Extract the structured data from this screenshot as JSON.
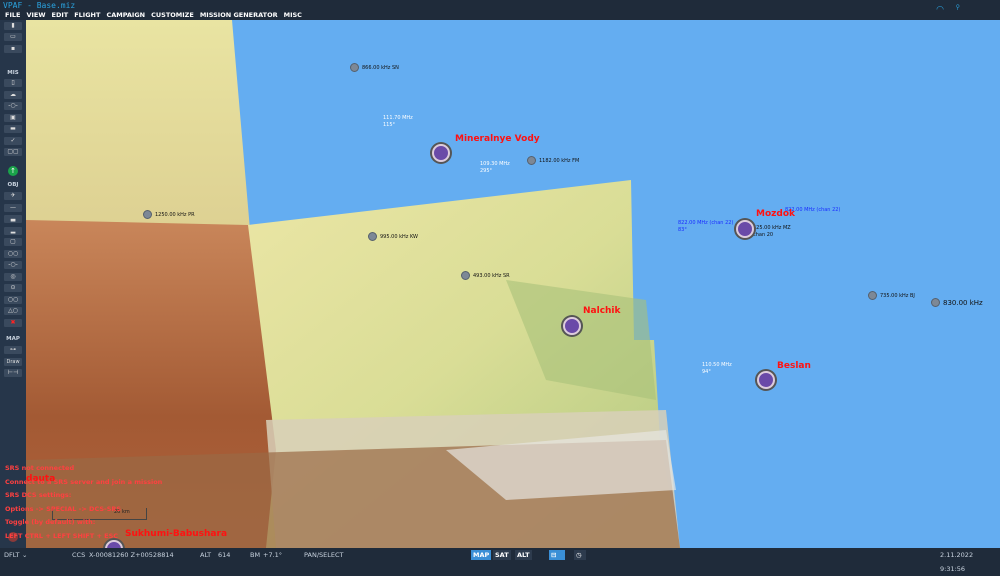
{
  "title": "VPAF - Base.miz",
  "menu": [
    "FILE",
    "VIEW",
    "EDIT",
    "FLIGHT",
    "CAMPAIGN",
    "CUSTOMIZE",
    "MISSION GENERATOR",
    "MISC"
  ],
  "toolbar": {
    "mis_label": "MIS",
    "obj_label": "OBJ",
    "map_label": "MAP",
    "draw_label": "Draw"
  },
  "beacons": [
    {
      "label": "866.00 kHz SN"
    },
    {
      "label": "1182.00 kHz FM"
    },
    {
      "label": "1250.00 kHz PR"
    },
    {
      "label": "995.00 kHz KW"
    },
    {
      "label": "493.00 kHz SR"
    },
    {
      "label": "735.00 kHz BJ"
    },
    {
      "label": "830.00 kHz"
    }
  ],
  "airfields": [
    {
      "name": "Mineralnye Vody",
      "freq1": "111.70 MHz",
      "hdg1": "115°",
      "freq2": "109.30 MHz",
      "hdg2": "295°"
    },
    {
      "name": "Mozdok",
      "freq1": "822.00 MHz (chan 22)",
      "hdg1": "83°",
      "freq2": "822.00 MHz (chan 22)",
      "extra": "525.00 kHz MZ",
      "extra2": "chan 20"
    },
    {
      "name": "Nalchik"
    },
    {
      "name": "Beslan",
      "freq1": "110.50 MHz",
      "hdg1": "94°"
    },
    {
      "name": "Sukhumi-Babushara"
    },
    {
      "name": "dauta"
    }
  ],
  "srs": [
    "SRS not connected",
    "Connect to a SRS server and join a mission",
    "SRS DCS settings:",
    "Options -> SPECIAL -> DCS-SRS",
    "Toggle (by default) with:",
    "LEFT CTRL + LEFT SHIFT + ESC"
  ],
  "status": {
    "profile": "DFLT",
    "coord_sys": "CCS",
    "coords": "X-00081260 Z+00528814",
    "alt_label": "ALT",
    "alt": "614",
    "mag": "BM",
    "mag_val": "+7.1°",
    "mode": "PAN/SELECT",
    "map_btn": "MAP",
    "sat_btn": "SAT",
    "alt_btn": "ALT",
    "datetime": "2.11.2022 9:31:56"
  },
  "scale": "20 km"
}
